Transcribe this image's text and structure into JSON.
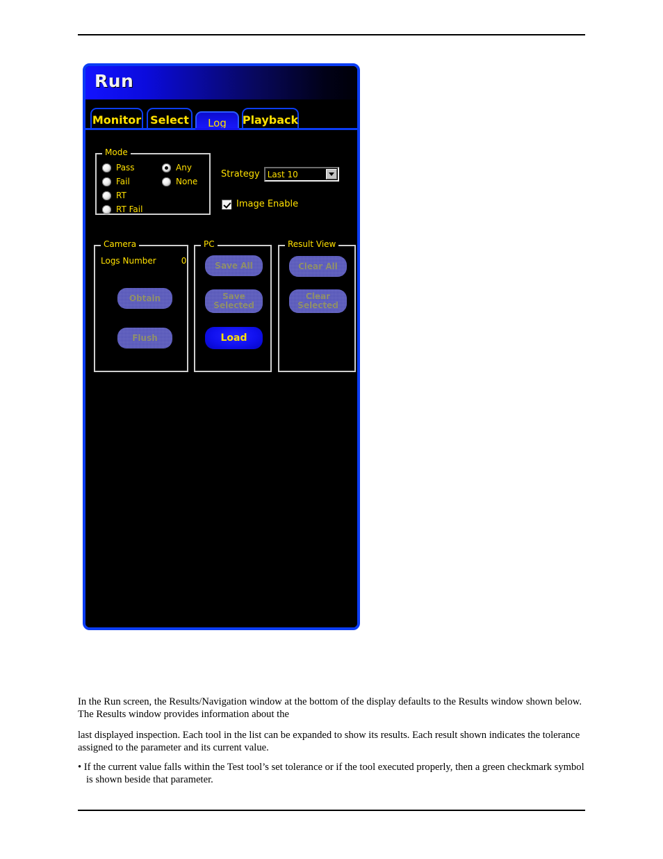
{
  "window": {
    "title": "Run",
    "tabs": [
      {
        "label": "Monitor",
        "active": false
      },
      {
        "label": "Select",
        "active": false
      },
      {
        "label": "Log",
        "active": true
      },
      {
        "label": "Playback",
        "active": false
      }
    ]
  },
  "mode_group": {
    "title": "Mode",
    "options_left": [
      {
        "label": "Pass",
        "checked": false
      },
      {
        "label": "Fail",
        "checked": false
      },
      {
        "label": "RT",
        "checked": false
      },
      {
        "label": "RT Fail",
        "checked": false
      }
    ],
    "options_right": [
      {
        "label": "Any",
        "checked": true
      },
      {
        "label": "None",
        "checked": false
      }
    ]
  },
  "strategy": {
    "label": "Strategy",
    "value": "Last 10",
    "arrow_icon": "chevron-down-icon"
  },
  "image_enable": {
    "label": "Image Enable",
    "checked": true
  },
  "camera_group": {
    "title": "Camera",
    "logs_number_label": "Logs Number",
    "logs_number_value": "0",
    "buttons": [
      {
        "label": "Obtain",
        "enabled": false
      },
      {
        "label": "Flush",
        "enabled": false
      }
    ]
  },
  "pc_group": {
    "title": "PC",
    "buttons": [
      {
        "label": "Save  All",
        "enabled": false
      },
      {
        "label": "Save\nSelected",
        "enabled": false
      },
      {
        "label": "Load",
        "enabled": true
      }
    ]
  },
  "result_view_group": {
    "title": "Result View",
    "buttons": [
      {
        "label": "Clear   All",
        "enabled": false
      },
      {
        "label": "Clear\nSelected",
        "enabled": false
      }
    ]
  },
  "document": {
    "paragraph_1": "In the Run screen, the Results/Navigation window at the bottom of the display defaults to the Results window shown below. The Results window provides information about the",
    "paragraph_2": "last displayed inspection. Each tool in the list can be expanded to show its results. Each result shown indicates the tolerance assigned to the parameter and its current value.",
    "bullet_1": "• If the current value falls within the Test tool’s set tolerance or if the tool executed properly, then a green checkmark symbol is shown beside that parameter."
  },
  "colors": {
    "accent_blue": "#0b3df5",
    "label_yellow": "#ffe000",
    "button_enabled": "#1010ee",
    "button_disabled": "#4a4ab4",
    "window_background": "#000000"
  }
}
